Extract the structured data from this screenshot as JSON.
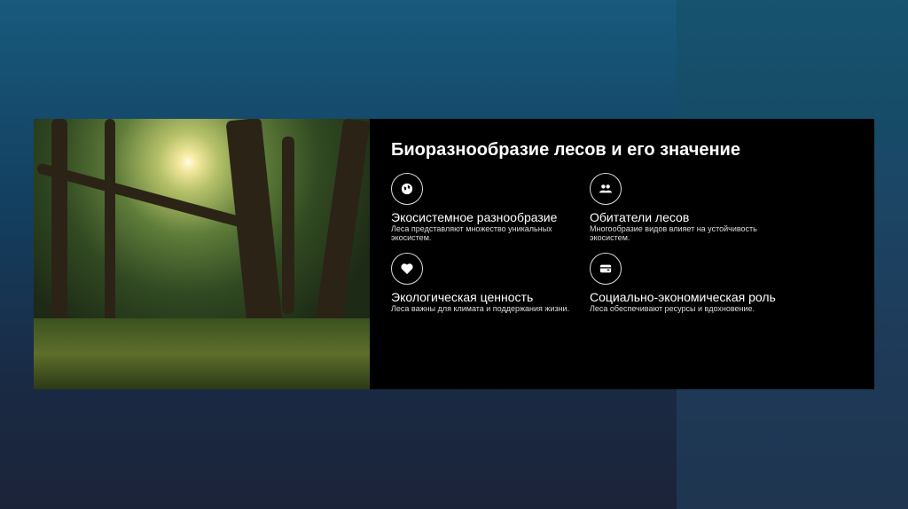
{
  "title": "Биоразнообразие лесов и его значение",
  "items": [
    {
      "icon": "globe-icon",
      "title": "Экосистемное разнообразие",
      "desc": "Леса представляют множество уникальных экосистем."
    },
    {
      "icon": "users-icon",
      "title": "Обитатели лесов",
      "desc": "Многообразие видов влияет на устойчивость экосистем."
    },
    {
      "icon": "heart-icon",
      "title": "Экологическая ценность",
      "desc": "Леса важны для климата и поддержания жизни."
    },
    {
      "icon": "wallet-icon",
      "title": "Социально-экономическая роль",
      "desc": "Леса обеспечивают ресурсы и вдохновение."
    }
  ]
}
